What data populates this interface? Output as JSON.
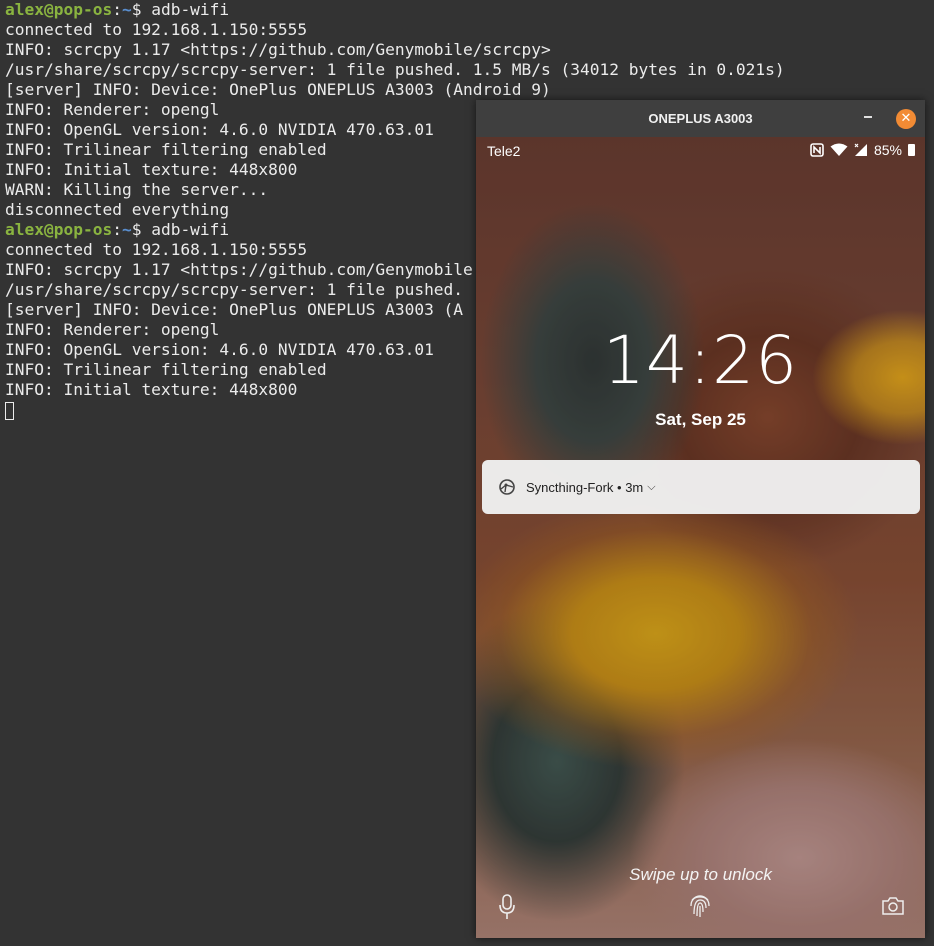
{
  "terminal": {
    "prompt": {
      "user_host": "alex@pop-os",
      "sep": ":",
      "path": "~",
      "symbol": "$ "
    },
    "lines": [
      {
        "type": "prompt",
        "cmd": "adb-wifi"
      },
      {
        "type": "out",
        "text": "connected to 192.168.1.150:5555"
      },
      {
        "type": "out",
        "text": "INFO: scrcpy 1.17 <https://github.com/Genymobile/scrcpy>"
      },
      {
        "type": "out",
        "text": "/usr/share/scrcpy/scrcpy-server: 1 file pushed. 1.5 MB/s (34012 bytes in 0.021s)"
      },
      {
        "type": "out",
        "text": "[server] INFO: Device: OnePlus ONEPLUS A3003 (Android 9)"
      },
      {
        "type": "out",
        "text": "INFO: Renderer: opengl"
      },
      {
        "type": "out",
        "text": "INFO: OpenGL version: 4.6.0 NVIDIA 470.63.01"
      },
      {
        "type": "out",
        "text": "INFO: Trilinear filtering enabled"
      },
      {
        "type": "out",
        "text": "INFO: Initial texture: 448x800"
      },
      {
        "type": "out",
        "text": "WARN: Killing the server..."
      },
      {
        "type": "out",
        "text": "disconnected everything"
      },
      {
        "type": "prompt",
        "cmd": "adb-wifi"
      },
      {
        "type": "out",
        "text": "connected to 192.168.1.150:5555"
      },
      {
        "type": "out",
        "text": "INFO: scrcpy 1.17 <https://github.com/Genymobile"
      },
      {
        "type": "out",
        "text": "/usr/share/scrcpy/scrcpy-server: 1 file pushed."
      },
      {
        "type": "out",
        "text": "[server] INFO: Device: OnePlus ONEPLUS A3003 (A"
      },
      {
        "type": "out",
        "text": "INFO: Renderer: opengl"
      },
      {
        "type": "out",
        "text": "INFO: OpenGL version: 4.6.0 NVIDIA 470.63.01"
      },
      {
        "type": "out",
        "text": "INFO: Trilinear filtering enabled"
      },
      {
        "type": "out",
        "text": "INFO: Initial texture: 448x800"
      }
    ]
  },
  "window": {
    "title": "ONEPLUS A3003",
    "minimize_icon": "minimize-icon",
    "close_glyph": "✕"
  },
  "phone": {
    "carrier": "Tele2",
    "battery": "85%",
    "status_icons": [
      "nfc-icon",
      "wifi-icon",
      "signal-icon",
      "battery-icon"
    ],
    "clock": "14:26",
    "date": "Sat, Sep 25",
    "notification": {
      "app": "Syncthing-Fork",
      "sep": " • ",
      "age": "3m",
      "icon": "syncthing-icon"
    },
    "swipe_hint": "Swipe up to unlock",
    "bottom_icons": [
      "mic-icon",
      "fingerprint-icon",
      "camera-icon"
    ]
  },
  "colors": {
    "terminal_bg": "#333333",
    "prompt_user": "#8ab440",
    "prompt_path": "#5a8fd0",
    "close_button": "#f28b34"
  }
}
